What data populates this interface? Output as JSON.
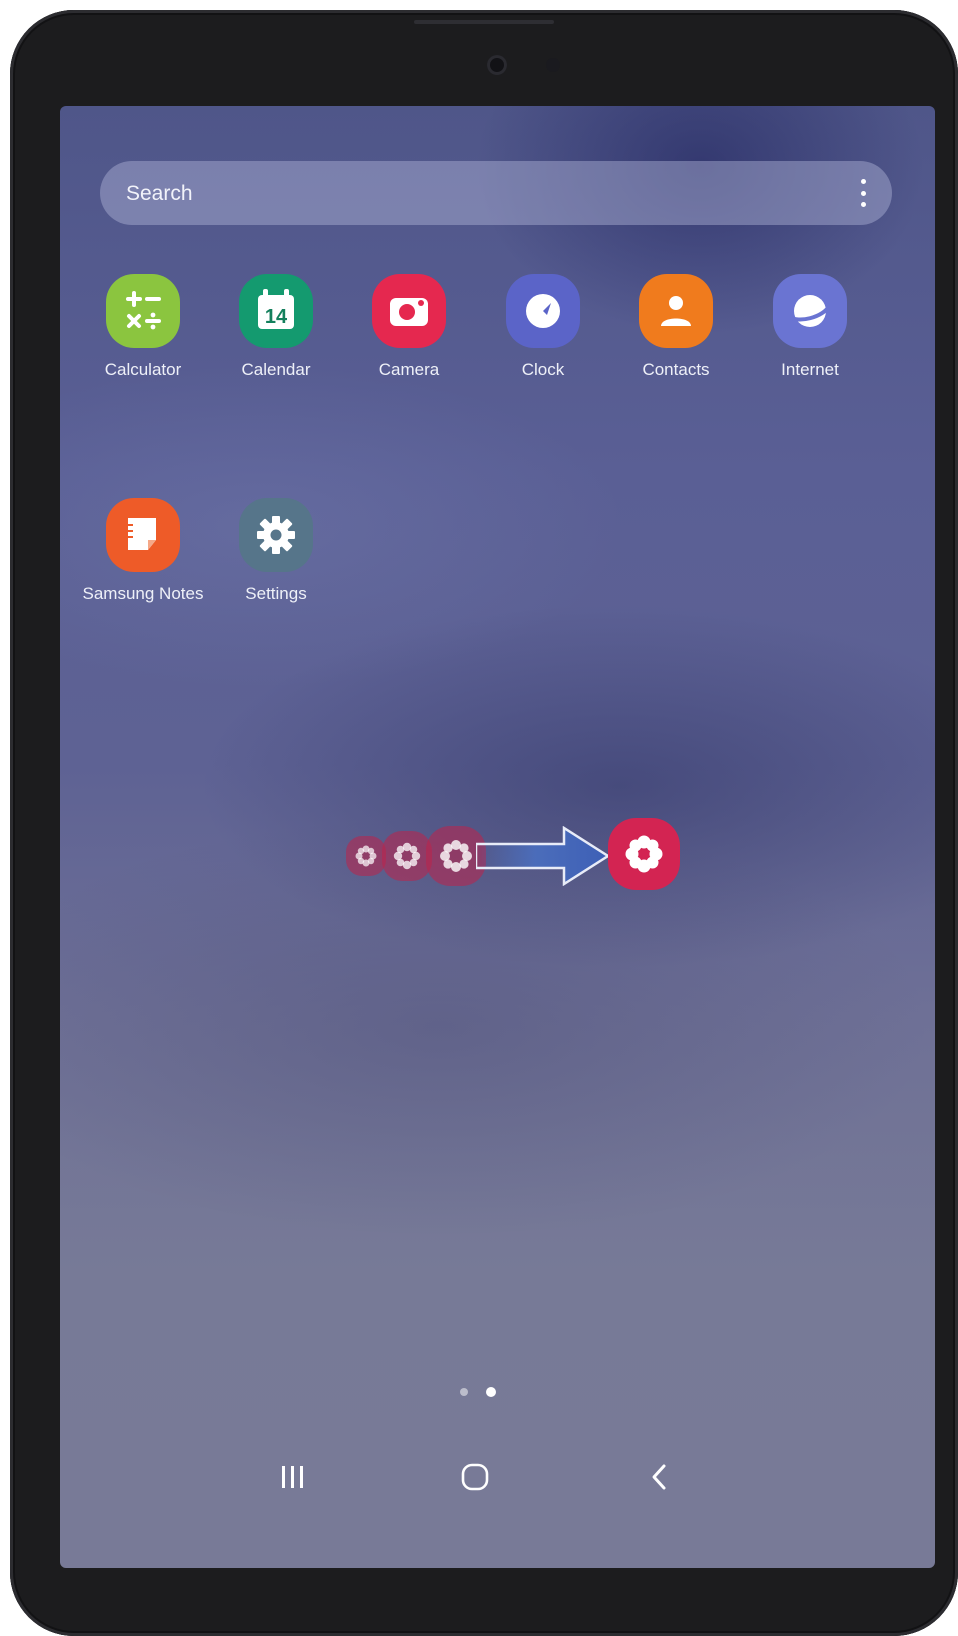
{
  "search": {
    "placeholder": "Search",
    "menu_icon": "more-vertical-icon"
  },
  "apps_row1": [
    {
      "label": "Calculator",
      "icon": "calculator-icon",
      "color": "#8bc53f"
    },
    {
      "label": "Calendar",
      "icon": "calendar-icon",
      "color": "#149a6f",
      "day": "14"
    },
    {
      "label": "Camera",
      "icon": "camera-icon",
      "color": "#e5284f"
    },
    {
      "label": "Clock",
      "icon": "clock-icon",
      "color": "#5b64c8"
    },
    {
      "label": "Contacts",
      "icon": "contacts-icon",
      "color": "#f07b1d"
    },
    {
      "label": "Internet",
      "icon": "internet-icon",
      "color": "#6a74d2"
    }
  ],
  "apps_row2": [
    {
      "label": "Samsung Notes",
      "icon": "notes-icon",
      "color": "#ee5b28"
    },
    {
      "label": "Settings",
      "icon": "settings-icon",
      "color": "#56758a"
    }
  ],
  "gesture": {
    "icon": "flower-app-icon",
    "arrow": "arrow-right-icon",
    "color": "#d32452"
  },
  "page_indicator": {
    "count": 2,
    "active": 2
  },
  "nav": {
    "recents": "recents-icon",
    "home": "home-icon",
    "back": "back-icon"
  }
}
